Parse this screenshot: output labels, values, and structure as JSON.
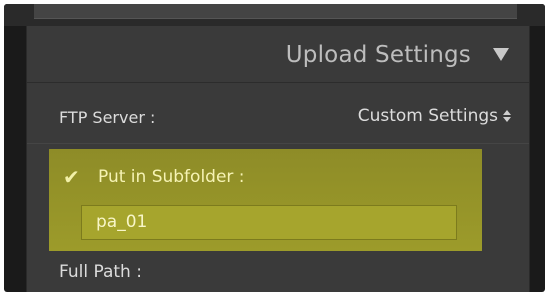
{
  "panel": {
    "title": "Upload Settings"
  },
  "ftp": {
    "label": "FTP Server :",
    "selected": "Custom Settings"
  },
  "subfolder": {
    "label": "Put in Subfolder :",
    "checked": true,
    "value": "pa_01"
  },
  "full_path": {
    "label": "Full Path :"
  },
  "colors": {
    "panel_bg": "#3a3a3a",
    "highlight": "#b2af2c",
    "text": "#dcdcdc"
  },
  "icons": {
    "collapse": "triangle-down-icon",
    "select_arrows": "up-down-arrows-icon",
    "checkbox": "checkmark-icon"
  }
}
